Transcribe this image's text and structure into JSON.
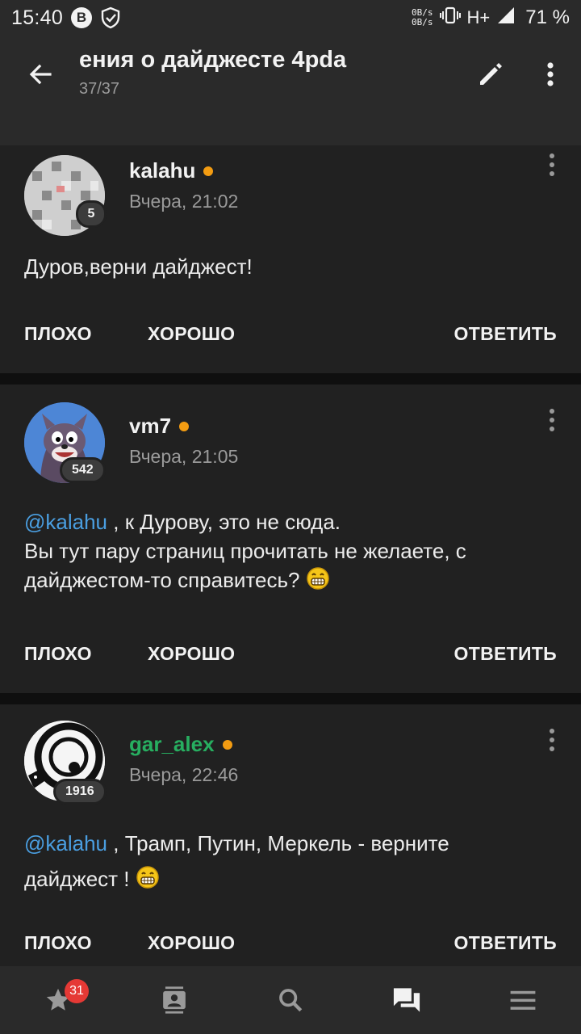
{
  "status_bar": {
    "time": "15:40",
    "net_up": "0B/s",
    "net_down": "0B/s",
    "network_type": "H+",
    "battery": "71 %",
    "icons": [
      "bitcoin-icon",
      "shield-check-icon",
      "vibrate-icon",
      "signal-icon"
    ]
  },
  "app_bar": {
    "title": "ения о дайджесте 4pda",
    "subtitle": "37/37",
    "icons": [
      "back-arrow-icon",
      "edit-pencil-icon",
      "more-vert-icon"
    ]
  },
  "posts": [
    {
      "author": "kalahu",
      "author_color": "#f2f2f2",
      "online": true,
      "date": "Вчера, 21:02",
      "reputation": "5",
      "avatar": "disco-ball-avatar",
      "body": [
        {
          "type": "text",
          "text": "Дуров,верни дайджест!"
        }
      ],
      "actions": {
        "bad": "ПЛОХО",
        "good": "ХОРОШО",
        "reply": "ОТВЕТИТЬ"
      }
    },
    {
      "author": "vm7",
      "author_color": "#f2f2f2",
      "online": true,
      "date": "Вчера, 21:05",
      "reputation": "542",
      "avatar": "cartoon-squirrel-avatar",
      "mention": "@kalahu",
      "line1_rest": ", к Дурову, это не сюда.",
      "line2": "Вы тут пару страниц прочитать не желаете, с",
      "line3": "дайджестом-то справитесь?",
      "emoji": "grin-smiley-icon",
      "actions": {
        "bad": "ПЛОХО",
        "good": "ХОРОШО",
        "reply": "ОТВЕТИТЬ"
      }
    },
    {
      "author": "gar_alex",
      "author_color": "#27ae60",
      "online": true,
      "date": "Вчера, 22:46",
      "reputation": "1916",
      "avatar": "black-white-ring-avatar",
      "mention": "@kalahu",
      "line1_rest": ", Трамп, Путин, Меркель - верните",
      "line2": "дайджест !",
      "emoji": "grin-smiley-icon",
      "actions": {
        "bad": "ПЛОХО",
        "good": "ХОРОШО",
        "reply": "ОТВЕТИТЬ"
      }
    }
  ],
  "bottom_nav": {
    "items": [
      "favorites-star-icon",
      "contacts-icon",
      "search-icon",
      "forum-chat-icon",
      "menu-icon"
    ],
    "favorites_badge": "31",
    "active": "forum-chat-icon"
  },
  "colors": {
    "background": "#0f0f0f",
    "card": "#212121",
    "bar": "#2a2a2a",
    "mention": "#4a9ee0",
    "online": "#f39c12",
    "badge": "#e53935"
  }
}
